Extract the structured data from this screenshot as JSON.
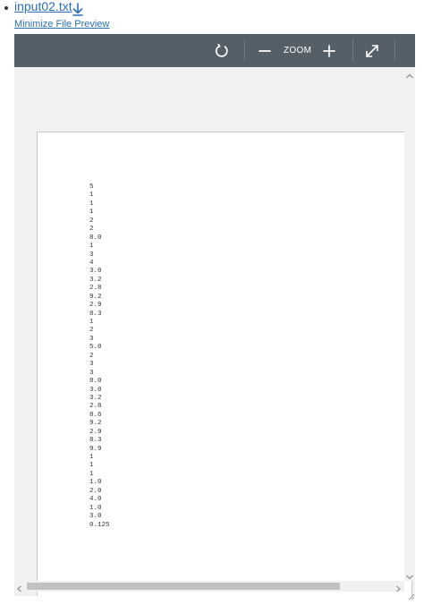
{
  "file": {
    "name": "input02.txt",
    "download_icon": "download-icon",
    "minimize_label": "Minimize File Preview"
  },
  "toolbar": {
    "rotate_icon": "rotate-icon",
    "zoom_out_icon": "minus-icon",
    "zoom_label": "ZOOM",
    "zoom_in_icon": "plus-icon",
    "fullscreen_icon": "expand-icon",
    "background_color": "#555f68"
  },
  "document": {
    "lines": [
      "5",
      "1",
      "1",
      "1",
      "2",
      "2",
      "8.0",
      "1",
      "3",
      "4",
      "3.0",
      "3.2",
      "2.8",
      "9.2",
      "2.9",
      "8.3",
      "1",
      "2",
      "3",
      "5.0",
      "2",
      "3",
      "3",
      "8.0",
      "3.0",
      "3.2",
      "2.8",
      "8.6",
      "9.2",
      "2.9",
      "8.3",
      "9.9",
      "1",
      "1",
      "1",
      "1.0",
      "2.0",
      "4.0",
      "1.0",
      "3.0",
      "0.125"
    ]
  }
}
